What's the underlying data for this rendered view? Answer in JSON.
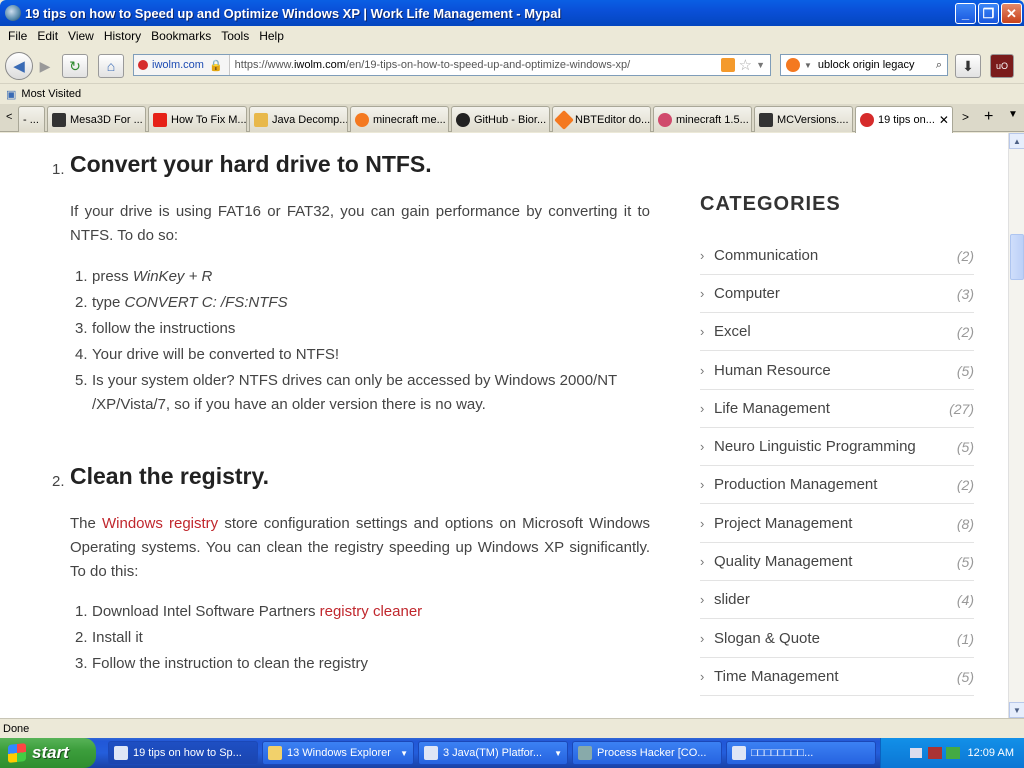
{
  "window": {
    "title": "19 tips on how to Speed up and Optimize Windows XP  |  Work Life Management - Mypal",
    "minimize": "_",
    "maximize": "❐",
    "close": "✕"
  },
  "menu": [
    "File",
    "Edit",
    "View",
    "History",
    "Bookmarks",
    "Tools",
    "Help"
  ],
  "navigation": {
    "back_icon": "arrow-left-icon",
    "site_identity": "iwolm.com",
    "url_prefix": "https://www.",
    "url_domain": "iwolm.com",
    "url_path": "/en/19-tips-on-how-to-speed-up-and-optimize-windows-xp/",
    "search_value": "ublock origin legacy"
  },
  "bookmarks": {
    "most_visited": "Most Visited"
  },
  "tabs": [
    {
      "label": "- ...",
      "color": "#888888"
    },
    {
      "label": "Mesa3D For ...",
      "color": "#333333"
    },
    {
      "label": "How To Fix M...",
      "color": "#e62117"
    },
    {
      "label": "Java Decomp...",
      "color": "#e8b84a"
    },
    {
      "label": "minecraft me...",
      "color": "#f47920"
    },
    {
      "label": "GitHub - Bior...",
      "color": "#222222"
    },
    {
      "label": "NBTEditor do...",
      "color": "#f47920"
    },
    {
      "label": "minecraft 1.5...",
      "color": "#d04a6c"
    },
    {
      "label": "MCVersions....",
      "color": "#333333"
    },
    {
      "label": "19 tips on...",
      "color": "#d62b2b"
    }
  ],
  "article": {
    "section1": {
      "number": "1.",
      "heading": "Convert your hard drive to NTFS.",
      "intro": "If your drive is using FAT16 or FAT32, you can gain performance by converting it to NTFS. To do so:",
      "steps": [
        {
          "n": "1.",
          "pre": "press ",
          "em": "WinKey + R",
          "post": ""
        },
        {
          "n": "2.",
          "pre": "type ",
          "em": "CONVERT C: /FS:NTFS",
          "post": ""
        },
        {
          "n": "3.",
          "pre": "follow the instructions",
          "em": "",
          "post": ""
        },
        {
          "n": "4.",
          "pre": "Your drive will be converted to NTFS!",
          "em": "",
          "post": ""
        },
        {
          "n": "5.",
          "pre": "Is your system older? NTFS drives can only be accessed by Windows 2000/NT",
          "em": "",
          "post": ""
        }
      ],
      "step5_cont": "/XP/Vista/7, so if you have an older version there is no way."
    },
    "section2": {
      "number": "2.",
      "heading": "Clean the registry.",
      "intro_pre": "The ",
      "intro_link": "Windows registry",
      "intro_post": " store configuration settings and options on Microsoft Windows Operating systems. You can clean the registry speeding up Windows XP significantly. To do this:",
      "steps": [
        {
          "n": "1.",
          "pre": "Download Intel Software Partners ",
          "link": "registry cleaner"
        },
        {
          "n": "2.",
          "pre": "Install it",
          "link": ""
        },
        {
          "n": "3.",
          "pre": "Follow the instruction to clean the registry",
          "link": ""
        }
      ]
    }
  },
  "sidebar": {
    "title": "CATEGORIES",
    "categories": [
      {
        "name": "Communication",
        "count": "(2)"
      },
      {
        "name": "Computer",
        "count": "(3)"
      },
      {
        "name": "Excel",
        "count": "(2)"
      },
      {
        "name": "Human Resource",
        "count": "(5)"
      },
      {
        "name": "Life Management",
        "count": "(27)"
      },
      {
        "name": "Neuro Linguistic Programming",
        "count": "(5)"
      },
      {
        "name": "Production Management",
        "count": "(2)"
      },
      {
        "name": "Project Management",
        "count": "(8)"
      },
      {
        "name": "Quality Management",
        "count": "(5)"
      },
      {
        "name": "slider",
        "count": "(4)"
      },
      {
        "name": "Slogan & Quote",
        "count": "(1)"
      },
      {
        "name": "Time Management",
        "count": "(5)"
      }
    ]
  },
  "status": "Done",
  "taskbar": {
    "start": "start",
    "tasks": [
      {
        "label": "19 tips on how to Sp..."
      },
      {
        "label": "13 Windows Explorer"
      },
      {
        "label": "3 Java(TM) Platfor..."
      },
      {
        "label": "Process Hacker [CO..."
      },
      {
        "label": "□□□□□□□□..."
      }
    ],
    "clock": "12:09 AM"
  },
  "colors": {
    "accent_link": "#c0272d",
    "titlebar": "#0a50d8",
    "taskbar": "#245edc"
  }
}
